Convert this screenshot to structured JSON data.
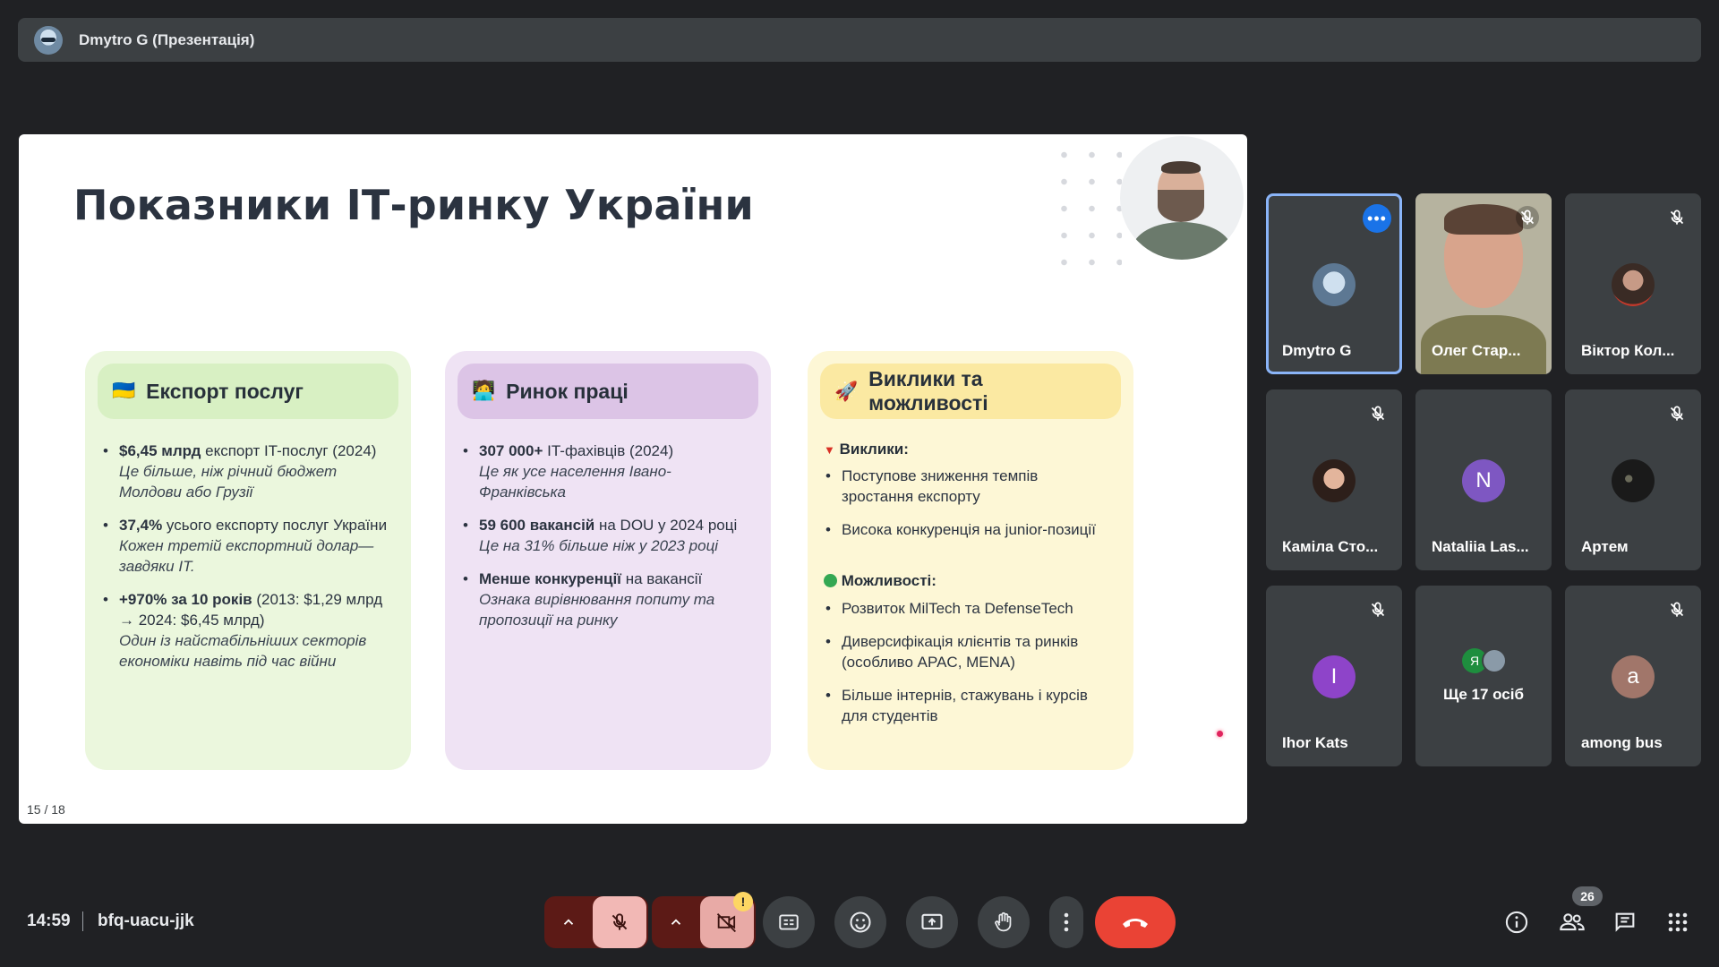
{
  "presenter_bar": {
    "title": "Dmytro G (Презентація)"
  },
  "slide": {
    "title": "Показники ІТ-ринку України",
    "page": "15 / 18",
    "cards": [
      {
        "emoji": "🇺🇦",
        "title": "Експорт послуг",
        "items": [
          {
            "bold": "$6,45 млрд",
            "text": " експорт IT-послуг (2024)",
            "note": "Це більше, ніж річний бюджет Молдови або Грузії"
          },
          {
            "bold": "37,4%",
            "text": " усього експорту послуг України",
            "note": "Кожен третій експортний долар—завдяки IT."
          },
          {
            "bold": "+970% за 10 років",
            "text": " (2013: $1,29 млрд → 2024: $6,45 млрд)",
            "note": "Один із найстабільніших секторів економіки навіть під час війни"
          }
        ]
      },
      {
        "emoji": "🧑‍💻",
        "title": "Ринок праці",
        "items": [
          {
            "bold": "307 000+",
            "text": " IT-фахівців (2024)",
            "note": "Це як усе населення Івано-Франківська"
          },
          {
            "bold": "59 600 вакансій",
            "text": " на DOU у 2024 році",
            "note": "Це на 31% більше ніж у 2023 році"
          },
          {
            "bold": "Менше конкуренції",
            "text": " на вакансії",
            "note": "Ознака вирівнювання попиту та пропозиції на ринку"
          }
        ]
      },
      {
        "emoji": "🚀",
        "title_line1": "Виклики та",
        "title_line2": "можливості",
        "challenges_label": "Виклики:",
        "challenges": [
          "Поступове зниження темпів зростання експорту",
          "Висока конкуренція на junior-позиції"
        ],
        "opportunities_label": "Можливості:",
        "opportunities": [
          "Розвиток MilTech та DefenseTech",
          "Диверсифікація клієнтів та ринків (особливо APAC, MENA)",
          "Більше інтернів, стажувань і курсів для студентів"
        ]
      }
    ]
  },
  "participants": [
    {
      "name": "Dmytro G",
      "type": "avatar-image",
      "active": true,
      "more": "•••"
    },
    {
      "name": "Олег Стар...",
      "type": "video",
      "muted": true
    },
    {
      "name": "Віктор Кол...",
      "type": "avatar-image",
      "muted": true
    },
    {
      "name": "Каміла Сто...",
      "type": "avatar-image",
      "muted": true
    },
    {
      "name": "Nataliia Las...",
      "type": "initial",
      "initial": "N",
      "color": "#7e57c2"
    },
    {
      "name": "Артем",
      "type": "avatar-image",
      "muted": true
    },
    {
      "name": "Ihor Kats",
      "type": "initial",
      "initial": "I",
      "color": "#8e44c9",
      "muted": true
    },
    {
      "name": "Ще 17 осіб",
      "type": "more",
      "mini_initial": "Я"
    },
    {
      "name": "among bus",
      "type": "initial",
      "initial": "a",
      "color": "#a1766a",
      "muted": true
    }
  ],
  "bottom": {
    "time": "14:59",
    "meeting_code": "bfq-uacu-jjk",
    "people_count": "26",
    "camera_warning": "!"
  },
  "colors": {
    "end_call": "#ea4335",
    "active_outline": "#8ab4f8",
    "mute_bg": "#f2b8b5"
  }
}
